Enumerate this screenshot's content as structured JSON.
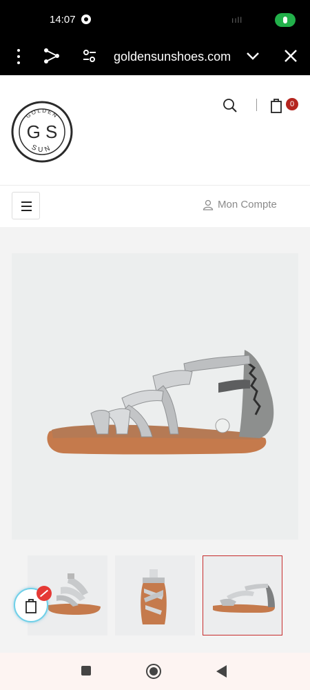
{
  "status_bar": {
    "time": "14:07",
    "signal_text": "ııll"
  },
  "browser": {
    "url": "goldensunshoes.com",
    "icons": [
      "more-vert-icon",
      "share-icon",
      "tune-icon",
      "chevron-down-icon",
      "close-icon"
    ]
  },
  "header": {
    "logo": {
      "top_text": "GOLDEN",
      "initials": "G S",
      "bottom_text": "SUN"
    },
    "cart_count": "0"
  },
  "nav": {
    "account_label": "Mon Compte"
  },
  "gallery": {
    "thumbnails": [
      {
        "name": "thumb-side-view",
        "active": false
      },
      {
        "name": "thumb-front-view",
        "active": false
      },
      {
        "name": "thumb-profile-view",
        "active": true
      }
    ]
  },
  "colors": {
    "badge": "#b5251f",
    "active_thumb_border": "#c62b2b",
    "float_cart_ring": "#6fd0e8"
  }
}
